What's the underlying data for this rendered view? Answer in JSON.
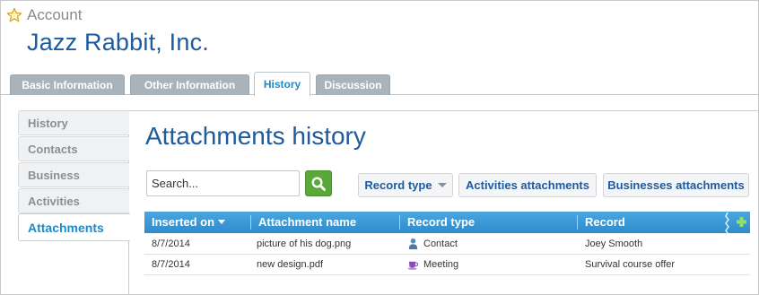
{
  "header": {
    "entity_type": "Account",
    "record_name": "Jazz Rabbit, Inc."
  },
  "tabs": [
    {
      "label": "Basic Information",
      "active": false
    },
    {
      "label": "Other Information",
      "active": false
    },
    {
      "label": "History",
      "active": true
    },
    {
      "label": "Discussion",
      "active": false
    }
  ],
  "sidebar": {
    "items": [
      {
        "label": "History",
        "active": false
      },
      {
        "label": "Contacts",
        "active": false
      },
      {
        "label": "Business",
        "active": false
      },
      {
        "label": "Activities",
        "active": false
      },
      {
        "label": "Attachments",
        "active": true
      }
    ]
  },
  "main": {
    "title": "Attachments history",
    "search": {
      "placeholder": "Search...",
      "value": ""
    },
    "filters": {
      "record_type": "Record type",
      "activities": "Activities attachments",
      "businesses": "Businesses attachments"
    },
    "table": {
      "columns": [
        "Inserted on",
        "Attachment name",
        "Record type",
        "Record"
      ],
      "rows": [
        {
          "inserted_on": "8/7/2014",
          "attachment_name": "picture of his dog.png",
          "record_type": "Contact",
          "record_type_icon": "person-icon",
          "record": "Joey Smooth"
        },
        {
          "inserted_on": "8/7/2014",
          "attachment_name": "new design.pdf",
          "record_type": "Meeting",
          "record_type_icon": "coffee-cup-icon",
          "record": "Survival course offer"
        }
      ]
    }
  },
  "colors": {
    "brand_blue": "#1e5a9e",
    "accent_blue": "#1f8ac9",
    "grid_header": "#3d9bd6",
    "search_green": "#58a83a",
    "tab_grey": "#a9b3bb"
  }
}
